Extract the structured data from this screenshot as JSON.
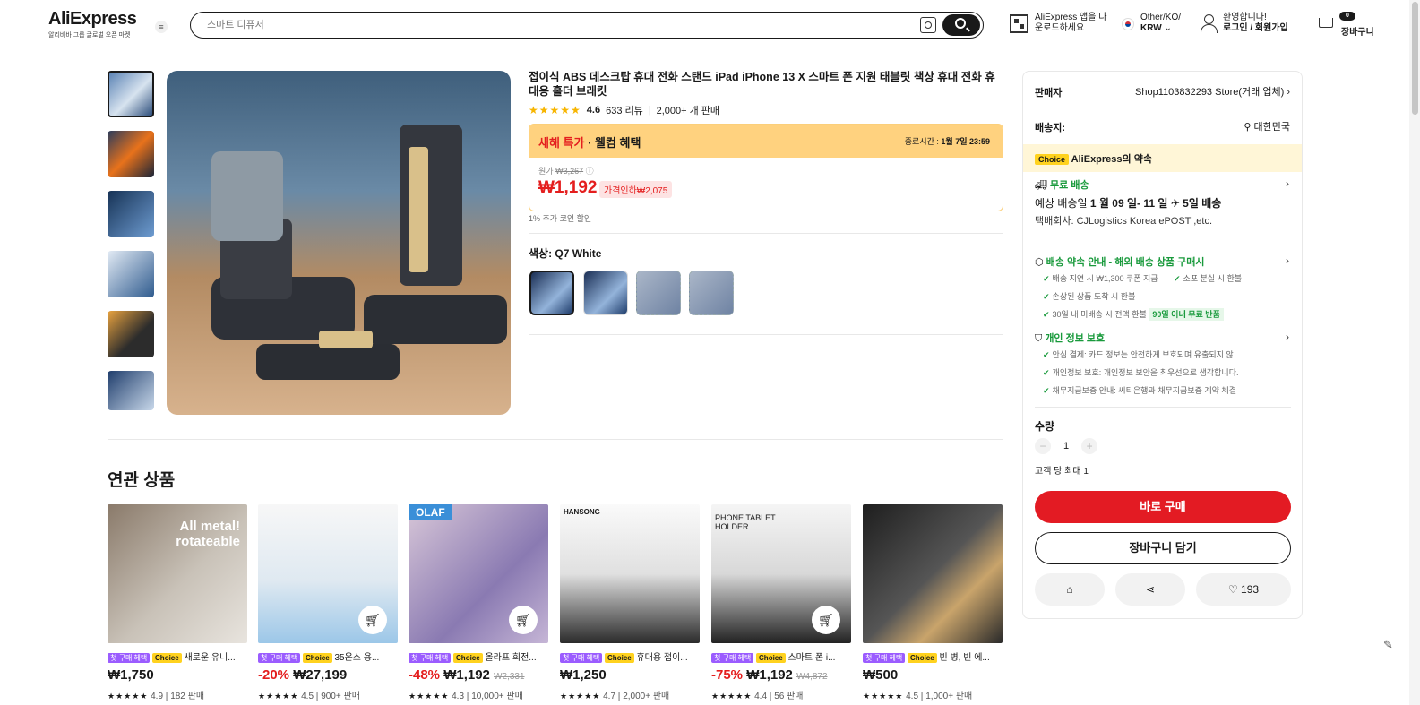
{
  "header": {
    "logo": "AliExpress",
    "logo_sub": "알리바바 그룹 글로벌 오픈 마켓",
    "search_placeholder": "스마트 디퓨저",
    "app_line1": "AliExpress 앱을 다",
    "app_line2": "운로드하세요",
    "region_line1": "Other/KO/",
    "region_line2": "KRW",
    "login_line1": "환영합니다!",
    "login_line2": "로그인 / 회원가입",
    "cart_count": "0",
    "cart_label": "장바구니"
  },
  "product": {
    "title": "접이식 ABS 데스크탑 휴대 전화 스탠드 iPad iPhone 13 X 스마트 폰 지원 태블릿 책상 휴대 전화 휴대용 홀더 브래킷",
    "rating": "4.6",
    "reviews": "633 리뷰",
    "sold": "2,000+ 개 판매",
    "deal_title_red": "새해 특가",
    "deal_title_rest": " · 웰컴 혜택",
    "deal_end_label": "종료시간 :",
    "deal_end_time": "1월 7일 23:59",
    "orig_label": "원가",
    "orig_price": "₩3,267",
    "price": "₩1,192",
    "price_off": "가격인하₩2,075",
    "coin": "1% 추가 코인 할인",
    "color_label": "색상: Q7 White"
  },
  "panel": {
    "seller_label": "판매자",
    "seller_value": "Shop1103832293 Store(거래 업체)",
    "ship_label": "배송지:",
    "ship_value": "대한민국",
    "choice_tag": "Choice",
    "choice_text": "AliExpress의 약속",
    "free_ship": "무료 배송",
    "delivery_prefix": "예상 배송일",
    "delivery_dates": "1 월 09 일- 11 일",
    "delivery_days": "5일 배송",
    "carrier_label": "택배회사:",
    "carrier_1": "CJLogistics",
    "carrier_2": "Korea ePOST ,etc.",
    "promise_title": "배송 약속 안내 - 해외 배송 상품 구매시",
    "promise_1": "배송 지연 시 ₩1,300 쿠폰 지급",
    "promise_2": "소포 분실 시 환불",
    "promise_3": "손상된 상품 도착 시 환불",
    "promise_4": "30일 내 미배송 시 전액 환불",
    "promise_badge": "90일 이내 무료 반품",
    "privacy_title": "개인 정보 보호",
    "privacy_1": "안심 결제: 카드 정보는 안전하게 보호되며 유출되지 않...",
    "privacy_2": "개인정보 보호: 개인정보 보안을 최우선으로 생각합니다.",
    "privacy_3": "채무지급보증 안내: 씨티은행과 채무지급보증 계약 체결",
    "qty_label": "수량",
    "qty_value": "1",
    "limit": "고객 당 최대 1",
    "buy": "바로 구매",
    "add_cart": "장바구니 담기",
    "wish_count": "193"
  },
  "related": {
    "title": "연관 상품",
    "tag1": "첫 구매 혜택",
    "tag2": "Choice",
    "items": [
      {
        "name": "새로운 유니...",
        "discount": "",
        "price": "₩1,750",
        "old": "",
        "rating": "4.9",
        "sold": "182 판매",
        "overlay": "All metal! rotateable"
      },
      {
        "name": "35온스 용...",
        "discount": "-20%",
        "price": "₩27,199",
        "old": "",
        "rating": "4.5",
        "sold": "900+ 판매",
        "overlay": ""
      },
      {
        "name": "올라프 회전...",
        "discount": "-48%",
        "price": "₩1,192",
        "old": "₩2,331",
        "rating": "4.3",
        "sold": "10,000+ 판매",
        "overlay": "OLAF"
      },
      {
        "name": "휴대용 접이...",
        "discount": "",
        "price": "₩1,250",
        "old": "",
        "rating": "4.7",
        "sold": "2,000+ 판매",
        "overlay": "HANSONG"
      },
      {
        "name": "스마트 폰 i...",
        "discount": "-75%",
        "price": "₩1,192",
        "old": "₩4,872",
        "rating": "4.4",
        "sold": "56 판매",
        "overlay": "PHONE TABLET HOLDER"
      },
      {
        "name": "빈 병, 빈 에...",
        "discount": "",
        "price": "₩500",
        "old": "",
        "rating": "4.5",
        "sold": "1,000+ 판매",
        "overlay": ""
      }
    ]
  }
}
